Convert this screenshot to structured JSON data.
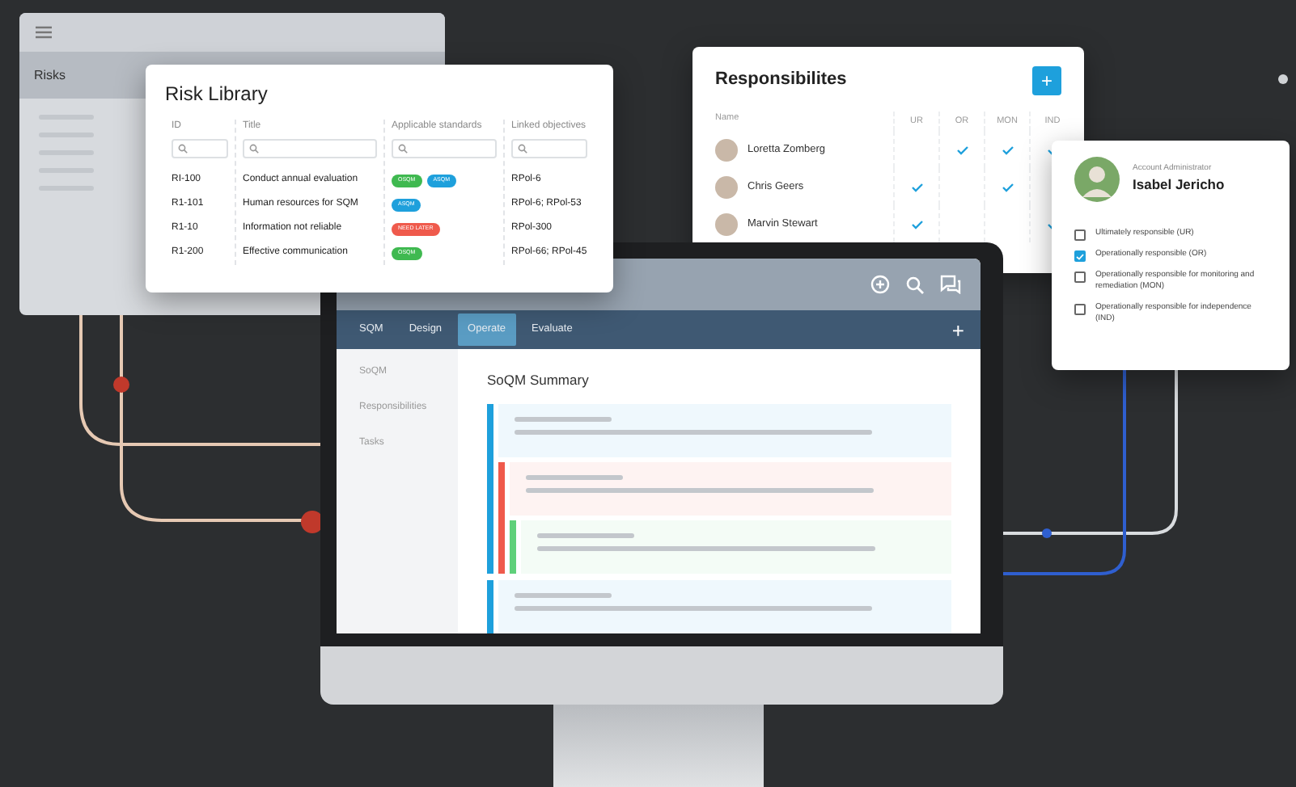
{
  "back_window": {
    "title": "Risks"
  },
  "risk_library": {
    "title": "Risk Library",
    "columns": [
      "ID",
      "Title",
      "Applicable standards",
      "Linked objectives"
    ],
    "rows": [
      {
        "id": "RI-100",
        "title": "Conduct annual evaluation",
        "tags": [
          {
            "label": "OSQM",
            "color": "#3fb950"
          },
          {
            "label": "ASQM",
            "color": "#1ea0dc"
          }
        ],
        "objectives": "RPol-6"
      },
      {
        "id": "R1-101",
        "title": "Human resources for SQM",
        "tags": [
          {
            "label": "ASQM",
            "color": "#1ea0dc"
          }
        ],
        "objectives": "RPol-6; RPol-53"
      },
      {
        "id": "R1-10",
        "title": "Information not reliable",
        "tags": [
          {
            "label": "NEED LATER",
            "color": "#ef5a4c"
          }
        ],
        "objectives": "RPol-300"
      },
      {
        "id": "R1-200",
        "title": "Effective communication",
        "tags": [
          {
            "label": "OSQM",
            "color": "#3fb950"
          }
        ],
        "objectives": "RPol-66; RPol-45"
      }
    ]
  },
  "responsibilities": {
    "title": "Responsibilites",
    "add_label": "+",
    "columns": [
      "Name",
      "UR",
      "OR",
      "MON",
      "IND"
    ],
    "rows": [
      {
        "name": "Loretta Zomberg",
        "checks": [
          false,
          true,
          true,
          true
        ]
      },
      {
        "name": "Chris Geers",
        "checks": [
          true,
          false,
          true,
          false
        ]
      },
      {
        "name": "Marvin Stewart",
        "checks": [
          true,
          false,
          false,
          true
        ]
      }
    ]
  },
  "account": {
    "role": "Account Administrator",
    "name": "Isabel Jericho",
    "options": [
      {
        "label": "Ultimately responsible (UR)",
        "checked": false
      },
      {
        "label": "Operationally responsible (OR)",
        "checked": true
      },
      {
        "label": "Operationally responsible for monitoring and remediation (MON)",
        "checked": false
      },
      {
        "label": "Operationally responsible for independence (IND)",
        "checked": false
      }
    ]
  },
  "app": {
    "tabs": [
      {
        "label": "SQM",
        "selected": false
      },
      {
        "label": "Design",
        "selected": false
      },
      {
        "label": "Operate",
        "selected": true
      },
      {
        "label": "Evaluate",
        "selected": false
      }
    ],
    "add_label": "+",
    "sidebar": [
      "SoQM",
      "Responsibilities",
      "Tasks"
    ],
    "summary_title": "SoQM Summary",
    "summary": [
      {
        "color": "#1ea0dc",
        "children": [
          {
            "color": "#ef5a4c",
            "children": [
              {
                "color": "#5fd07a"
              }
            ]
          }
        ]
      },
      {
        "color": "#1ea0dc"
      }
    ]
  }
}
